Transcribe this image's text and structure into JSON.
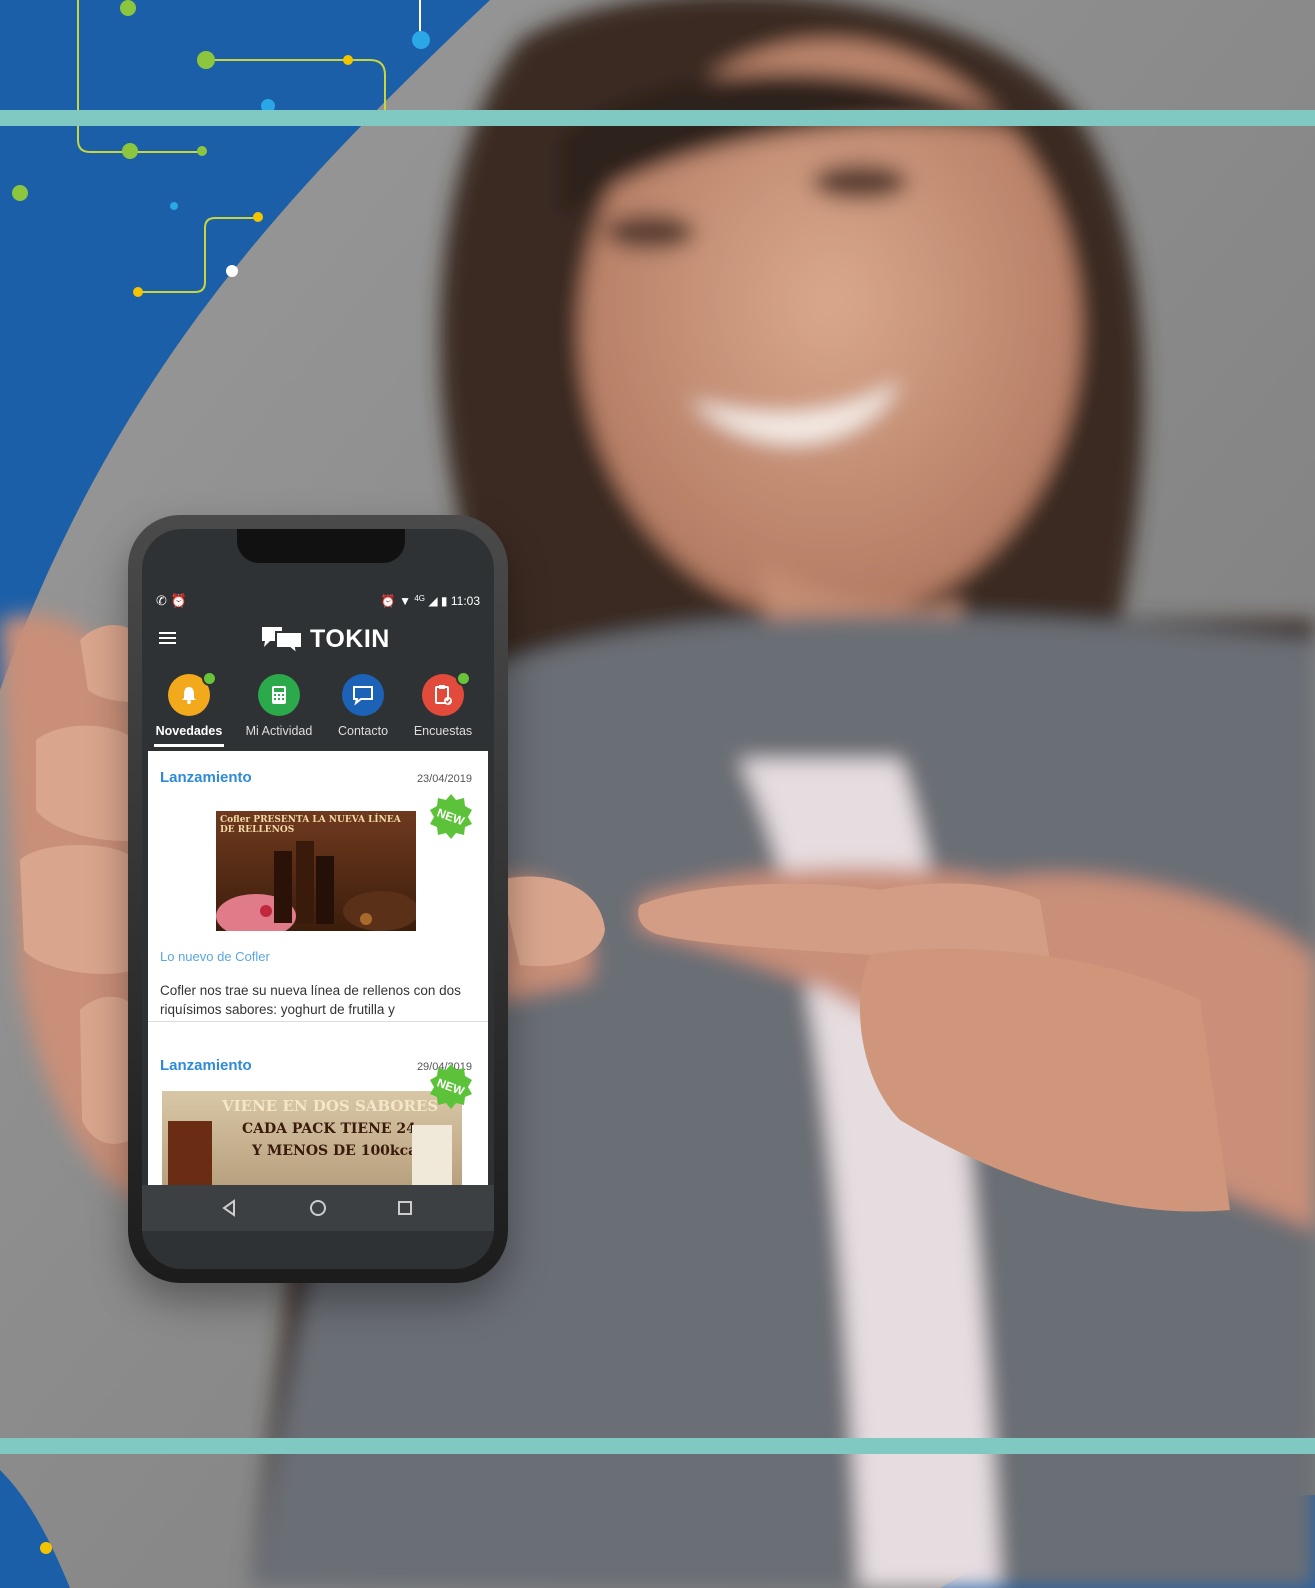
{
  "status_bar": {
    "time": "11:03",
    "signal_label": "4G"
  },
  "app": {
    "title": "TOKIN"
  },
  "tabs": [
    {
      "label": "Novedades",
      "icon": "bell-icon",
      "color": "#f2a91c",
      "active": true,
      "dot": true
    },
    {
      "label": "Mi Actividad",
      "icon": "calculator-icon",
      "color": "#2ba94b",
      "active": false,
      "dot": false
    },
    {
      "label": "Contacto",
      "icon": "chat-icon",
      "color": "#1c63b7",
      "active": false,
      "dot": false
    },
    {
      "label": "Encuestas",
      "icon": "clipboard-icon",
      "color": "#e24b3b",
      "active": false,
      "dot": true
    }
  ],
  "cards": [
    {
      "category": "Lanzamiento",
      "date": "23/04/2019",
      "badge": "NEW",
      "image_text": "Cofler PRESENTA LA NUEVA LÍNEA DE RELLENOS",
      "subtitle": "Lo nuevo de Cofler",
      "body": "Cofler nos trae su nueva línea de rellenos con dos riquísimos sabores: yoghurt de frutilla y"
    },
    {
      "category": "Lanzamiento",
      "date": "29/04/2019",
      "badge": "NEW",
      "image_text_1": "VIENE EN DOS SABORES",
      "image_text_2": "CADA PACK TIENE 24u",
      "image_text_3": "Y MENOS DE 100kcal"
    }
  ],
  "colors": {
    "blue": "#1b5fa8",
    "teal": "#7fc9c2",
    "link_blue": "#2e8bd6",
    "badge_green": "#5cc23a"
  }
}
